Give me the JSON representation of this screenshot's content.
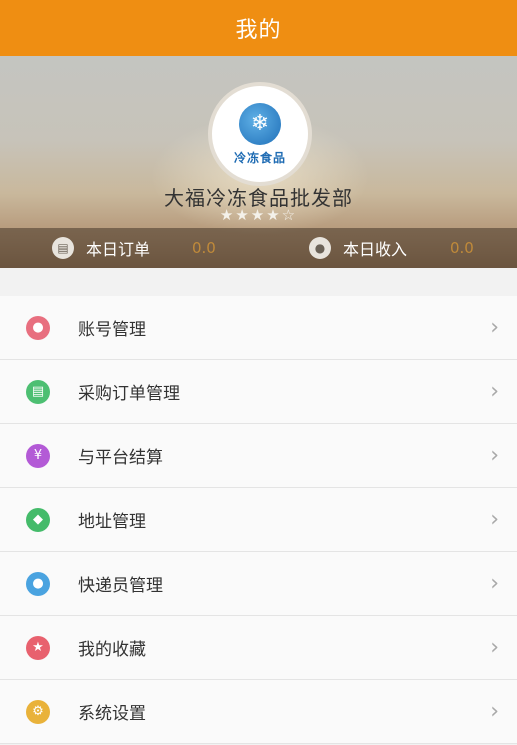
{
  "header": {
    "title": "我的"
  },
  "profile": {
    "logo_text": "冷冻食品",
    "store_name": "大福冷冻食品批发部",
    "rating_stars": "★★★★☆",
    "rating": 4.5
  },
  "stats": {
    "today_orders": {
      "label": "本日订单",
      "value": "0.0",
      "icon": "order-icon"
    },
    "today_income": {
      "label": "本日收入",
      "value": "0.0",
      "icon": "income-icon"
    }
  },
  "menu": {
    "items": [
      {
        "label": "账号管理",
        "icon": "user-icon",
        "icon_glyph": "●",
        "color": "#e86f7f"
      },
      {
        "label": "采购订单管理",
        "icon": "order-list-icon",
        "icon_glyph": "▤",
        "color": "#4dbf72"
      },
      {
        "label": "与平台结算",
        "icon": "yuan-icon",
        "icon_glyph": "¥",
        "color": "#b35ad6"
      },
      {
        "label": "地址管理",
        "icon": "location-icon",
        "icon_glyph": "◆",
        "color": "#44bb6a"
      },
      {
        "label": "快递员管理",
        "icon": "courier-icon",
        "icon_glyph": "●",
        "color": "#4aa3e0"
      },
      {
        "label": "我的收藏",
        "icon": "star-icon",
        "icon_glyph": "★",
        "color": "#e8616e"
      },
      {
        "label": "系统设置",
        "icon": "gear-icon",
        "icon_glyph": "⚙",
        "color": "#e9b23a"
      }
    ],
    "chevron": "›"
  }
}
